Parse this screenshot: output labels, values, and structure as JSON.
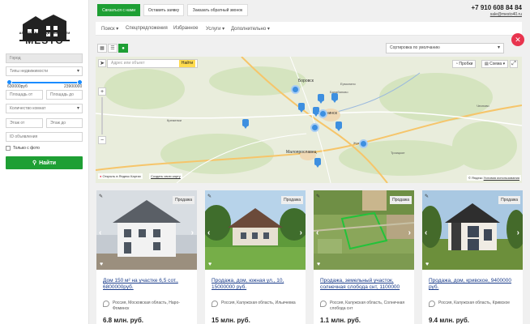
{
  "header": {
    "btn_contact": "Связаться с нами",
    "btn_request": "Оставить заявку",
    "btn_callback": "Заказать обратный звонок",
    "phone": "+7 910 608 84 84",
    "email": "sale@mesto40.ru"
  },
  "logo": {
    "subtitle": "АГЕНТСТВО НЕДВИЖИМОСТИ",
    "name": "MESTO"
  },
  "nav": {
    "items": [
      "Поиск",
      "Спецпредложения",
      "Избранное",
      "Услуги",
      "Дополнительно"
    ]
  },
  "filters": {
    "city_placeholder": "Город",
    "type_placeholder": "Типы недвижимости",
    "price_min": "630000руб",
    "price_max": "23900000",
    "area_from": "Площадь от",
    "area_to": "Площадь до",
    "rooms": "Количество комнат",
    "floor_from": "Этаж от",
    "floor_to": "Этаж до",
    "id_placeholder": "ID объявления",
    "photo_only": "Только с фото",
    "find_label": "Найти"
  },
  "sort": {
    "label": "Сортировка по умолчанию"
  },
  "map": {
    "search_placeholder": "Адрес или объект",
    "find_label": "Найти",
    "traffic_label": "Пробки",
    "scheme_label": "Схема",
    "open_in": "Открыть в Яндекс Картах",
    "create_map": "Создать свою карту",
    "terms": "Условия использования",
    "yandex": "© Яндекс",
    "labels": {
      "borovsk": "Боровск",
      "ermolino": "Ермолино",
      "balabanovo": "Балабаново",
      "obninsk": "Обнинск",
      "maloyaroslavets": "Малоярославец",
      "zhukov": "Жуков",
      "chesnokovo": "Чесново",
      "troitskoe": "Троицкое",
      "kremenki": "Кременки"
    }
  },
  "cards": [
    {
      "tag": "Продажа",
      "title": "Дом 150 м² на участке 6,5 сот., 6800000руб.",
      "location": "Россия, Московская область, Наро-Фоминск",
      "price": "6.8 млн. руб."
    },
    {
      "tag": "Продажа",
      "title": "Продажа, дом, южная ул., 10, 15000000 руб.",
      "location": "Россия, Калужская область, Ильичевка",
      "price": "15 млн. руб."
    },
    {
      "tag": "Продажа",
      "title": "Продажа, земельный участок, солнечная слобода снт, 1100000",
      "location": "Россия, Калужская область, Солнечная слобода снт",
      "price": "1.1 млн. руб."
    },
    {
      "tag": "Продажа",
      "title": "Продажа, дом, кривское, 9400000 руб.",
      "location": "Россия, Калужская область, Кривское",
      "price": "9.4 млн. руб."
    }
  ],
  "colors": {
    "accent_green": "#1e9f34",
    "close_red": "#e8344e",
    "marker_blue": "#3d8fe0",
    "link_blue": "#1a3c8a"
  }
}
